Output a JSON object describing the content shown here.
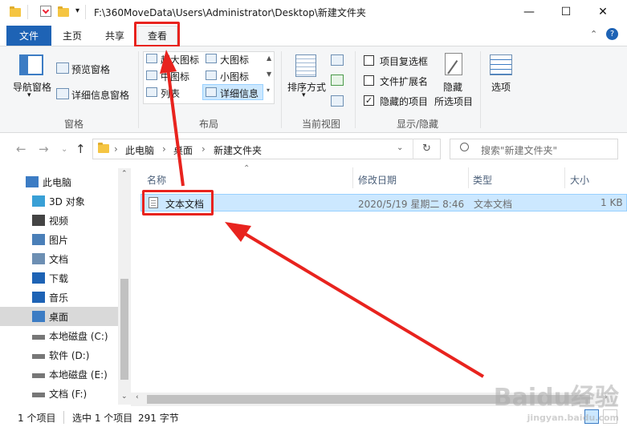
{
  "window": {
    "title": "F:\\360MoveData\\Users\\Administrator\\Desktop\\新建文件夹",
    "minimize": "—",
    "maximize": "☐",
    "close": "✕"
  },
  "ribbon_tabs": [
    "文件",
    "主页",
    "共享",
    "查看"
  ],
  "ribbon": {
    "nav_pane": "导航窗格",
    "preview_pane": "预览窗格",
    "details_pane": "详细信息窗格",
    "group_panes": "窗格",
    "layouts": [
      "超大图标",
      "大图标",
      "中图标",
      "小图标",
      "列表",
      "详细信息"
    ],
    "group_layout": "布局",
    "sort_by": "排序方式",
    "group_current_view": "当前视图",
    "item_checkboxes": "项目复选框",
    "file_extensions": "文件扩展名",
    "hidden_items": "隐藏的项目",
    "hide_selected_line1": "隐藏",
    "hide_selected_line2": "所选项目",
    "options": "选项",
    "group_show_hide": "显示/隐藏",
    "item_checkboxes_checked": false,
    "file_extensions_checked": false,
    "hidden_items_checked": true
  },
  "address": {
    "breadcrumbs": [
      "此电脑",
      "桌面",
      "新建文件夹"
    ],
    "search_placeholder": "搜索\"新建文件夹\""
  },
  "nav_items": [
    {
      "label": "此电脑",
      "icon": "computer-icon"
    },
    {
      "label": "3D 对象",
      "icon": "3d-objects-icon"
    },
    {
      "label": "视频",
      "icon": "video-icon"
    },
    {
      "label": "图片",
      "icon": "pictures-icon"
    },
    {
      "label": "文档",
      "icon": "documents-icon"
    },
    {
      "label": "下载",
      "icon": "download-icon"
    },
    {
      "label": "音乐",
      "icon": "music-icon"
    },
    {
      "label": "桌面",
      "icon": "desktop-icon"
    },
    {
      "label": "本地磁盘 (C:)",
      "icon": "drive-icon"
    },
    {
      "label": "软件 (D:)",
      "icon": "drive-icon"
    },
    {
      "label": "本地磁盘 (E:)",
      "icon": "drive-icon"
    },
    {
      "label": "文档 (F:)",
      "icon": "drive-icon"
    }
  ],
  "columns": [
    "名称",
    "修改日期",
    "类型",
    "大小"
  ],
  "files": [
    {
      "name": "文本文档",
      "modified": "2020/5/19 星期二 8:46",
      "type": "文本文档",
      "size": "1 KB"
    }
  ],
  "status": {
    "item_count": "1 个项目",
    "selected": "选中 1 个项目",
    "size": "291 字节"
  },
  "watermark": "Baidu经验",
  "watermark_sub": "jingyan.baidu.com",
  "colors": {
    "accent": "#1e63b5",
    "annotation": "#e8231e",
    "selection": "#cce8ff"
  }
}
